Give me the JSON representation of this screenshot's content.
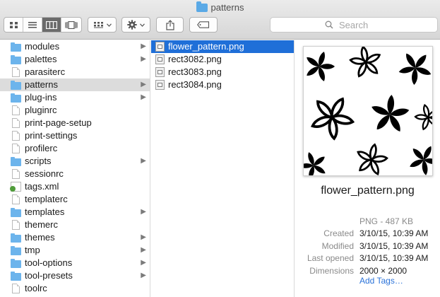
{
  "window": {
    "title": "patterns"
  },
  "toolbar": {
    "view_buttons": [
      {
        "icon": "icon-view-icon"
      },
      {
        "icon": "list-view-icon"
      },
      {
        "icon": "column-view-icon",
        "active": true
      },
      {
        "icon": "cover-flow-icon"
      }
    ],
    "search": {
      "placeholder": "Search"
    }
  },
  "column1": {
    "items": [
      {
        "name": "modules",
        "type": "folder",
        "has_children": true
      },
      {
        "name": "palettes",
        "type": "folder",
        "has_children": true
      },
      {
        "name": "parasiterc",
        "type": "doc",
        "has_children": false
      },
      {
        "name": "patterns",
        "type": "folder",
        "has_children": true,
        "selected": true
      },
      {
        "name": "plug-ins",
        "type": "folder",
        "has_children": true
      },
      {
        "name": "pluginrc",
        "type": "doc",
        "has_children": false
      },
      {
        "name": "print-page-setup",
        "type": "doc",
        "has_children": false
      },
      {
        "name": "print-settings",
        "type": "doc",
        "has_children": false
      },
      {
        "name": "profilerc",
        "type": "doc",
        "has_children": false
      },
      {
        "name": "scripts",
        "type": "folder",
        "has_children": true
      },
      {
        "name": "sessionrc",
        "type": "doc",
        "has_children": false
      },
      {
        "name": "tags.xml",
        "type": "xml",
        "has_children": false
      },
      {
        "name": "templaterc",
        "type": "doc",
        "has_children": false
      },
      {
        "name": "templates",
        "type": "folder",
        "has_children": true
      },
      {
        "name": "themerc",
        "type": "doc",
        "has_children": false
      },
      {
        "name": "themes",
        "type": "folder",
        "has_children": true
      },
      {
        "name": "tmp",
        "type": "folder",
        "has_children": true
      },
      {
        "name": "tool-options",
        "type": "folder",
        "has_children": true
      },
      {
        "name": "tool-presets",
        "type": "folder",
        "has_children": true
      },
      {
        "name": "toolrc",
        "type": "doc",
        "has_children": false
      }
    ]
  },
  "column2": {
    "items": [
      {
        "name": "flower_pattern.png",
        "selected": true
      },
      {
        "name": "rect3082.png"
      },
      {
        "name": "rect3083.png"
      },
      {
        "name": "rect3084.png"
      }
    ]
  },
  "preview": {
    "file_name": "flower_pattern.png",
    "kind_size": "PNG - 487 KB",
    "meta": [
      {
        "label": "Created",
        "value": "3/10/15, 10:39 AM"
      },
      {
        "label": "Modified",
        "value": "3/10/15, 10:39 AM"
      },
      {
        "label": "Last opened",
        "value": "3/10/15, 10:39 AM"
      },
      {
        "label": "Dimensions",
        "value": "2000 × 2000"
      }
    ],
    "add_tags": "Add Tags…"
  },
  "colors": {
    "selection_blue": "#1f6fd8",
    "selection_gray": "#dcdcdc",
    "folder_blue": "#6cb4ec",
    "link_blue": "#2b73d9"
  }
}
